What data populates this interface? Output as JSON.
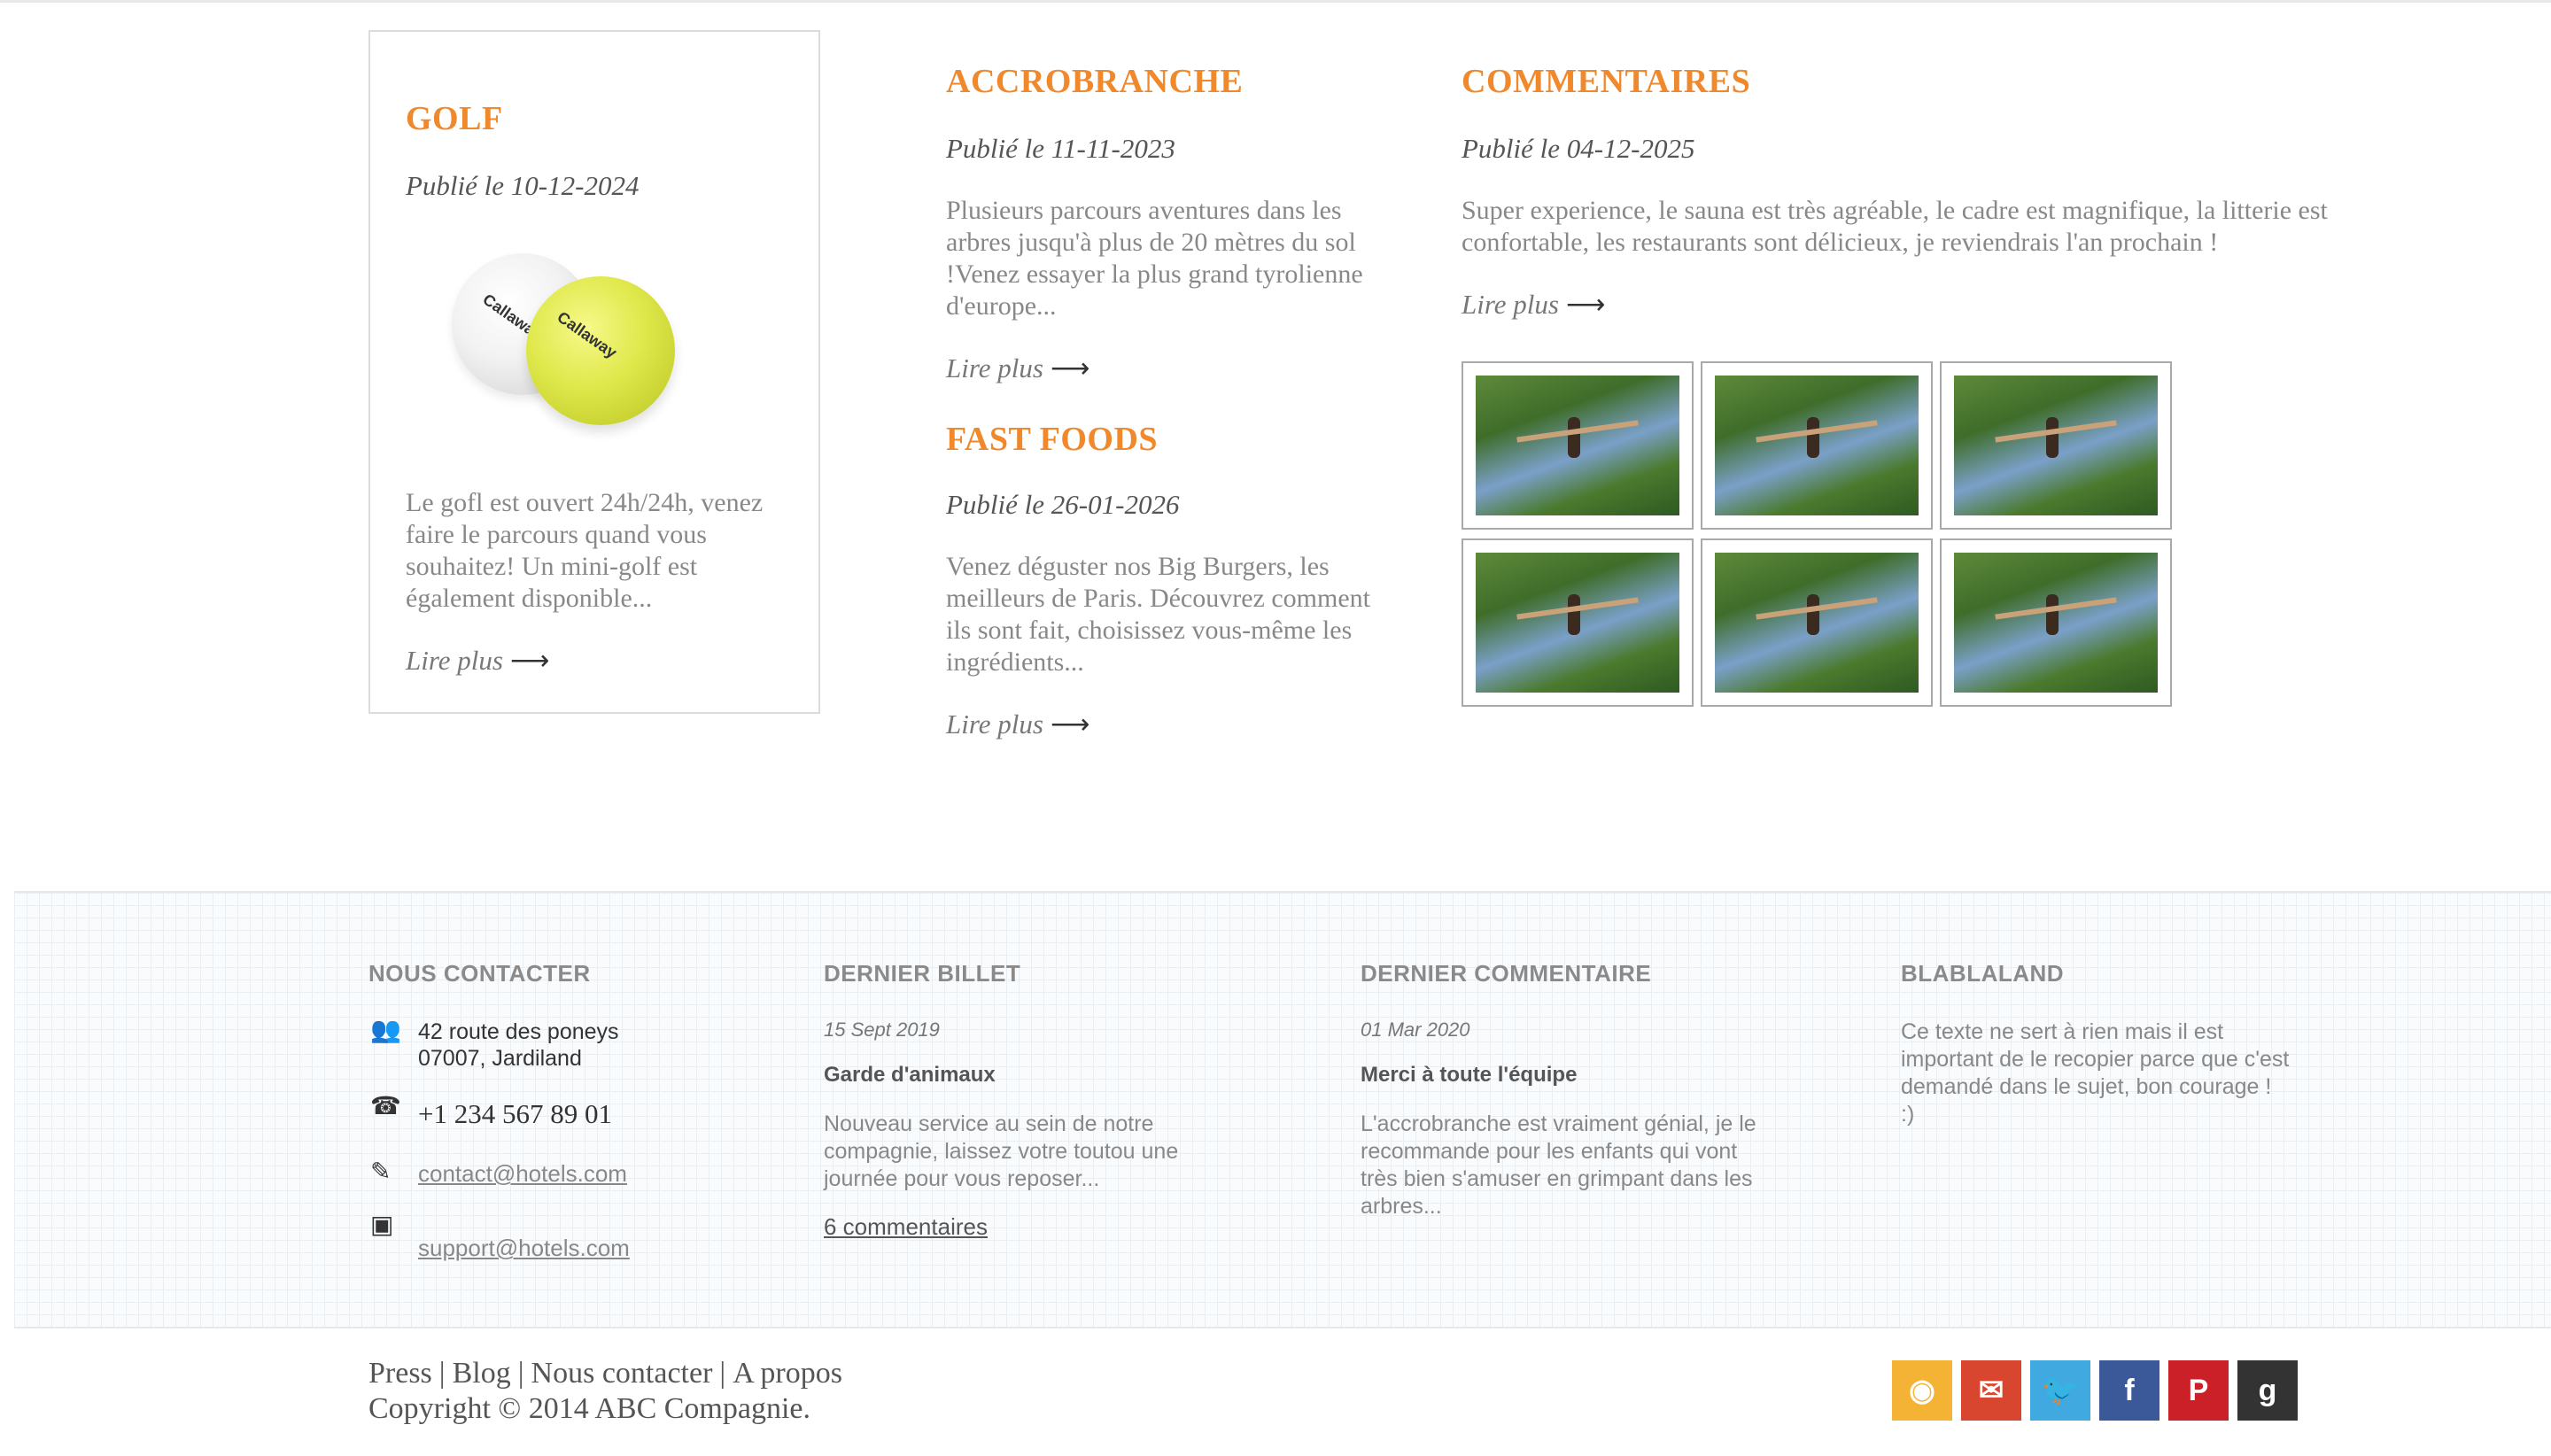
{
  "golf": {
    "title": "GOLF",
    "date": "Publié le 10-12-2024",
    "text": "Le gofl est ouvert 24h/24h, venez faire le parcours quand vous souhaitez! Un mini-golf est également disponible...",
    "more": "Lire plus",
    "ball_brand": "Callaway"
  },
  "accrobranche": {
    "title": "ACCROBRANCHE",
    "date": "Publié le 11-11-2023",
    "text": "Plusieurs parcours aventures dans les arbres jusqu'à plus de 20 mètres du sol !Venez essayer la plus grand tyrolienne d'europe...",
    "more": "Lire plus"
  },
  "fastfoods": {
    "title": "FAST FOODS",
    "date": "Publié le 26-01-2026",
    "text": "Venez déguster nos Big Burgers, les meilleurs de Paris. Découvrez comment ils sont fait, choisissez vous-même les ingrédients...",
    "more": "Lire plus"
  },
  "commentaires": {
    "title": "COMMENTAIRES",
    "date": "Publié le 04-12-2025",
    "text": "Super experience, le sauna est très agréable, le cadre est magnifique, la litterie est confortable, les restaurants sont délicieux, je reviendrais l'an prochain !",
    "more": "Lire plus",
    "gallery_count": 6
  },
  "footer": {
    "contact": {
      "heading": "NOUS CONTACTER",
      "address_line1": "42 route des poneys",
      "address_line2": "07007, Jardiland",
      "phone": "+1 234 567 89 01",
      "email1": "contact@hotels.com",
      "email2": "support@hotels.com"
    },
    "billet": {
      "heading": "DERNIER BILLET",
      "date": "15 Sept 2019",
      "title": "Garde d'animaux",
      "text": "Nouveau service au sein de notre compagnie, laissez votre toutou une journée pour vous reposer...",
      "comments": "6 commentaires"
    },
    "commentaire": {
      "heading": "DERNIER COMMENTAIRE",
      "date": "01 Mar 2020",
      "title": "Merci à toute l'équipe",
      "text": "L'accrobranche est vraiment génial, je le recommande pour les enfants qui vont très bien s'amuser en grimpant dans les arbres..."
    },
    "blablaland": {
      "heading": "BLABLALAND",
      "text": "Ce texte ne sert à rien mais il est important de le recopier parce que c'est demandé dans le sujet, bon courage ! :)"
    }
  },
  "bottom": {
    "links": [
      "Press",
      "Blog",
      "Nous contacter",
      "A propos"
    ],
    "separator": "|",
    "copyright": "Copyright © 2014 ABC Compagnie."
  },
  "social": [
    {
      "name": "rss-icon",
      "glyph": "◉",
      "color": "#f5b335"
    },
    {
      "name": "mail-icon",
      "glyph": "✉",
      "color": "#d9462f"
    },
    {
      "name": "twitter-icon",
      "glyph": "🐦",
      "color": "#3fa9e0"
    },
    {
      "name": "facebook-icon",
      "glyph": "f",
      "color": "#3b5998"
    },
    {
      "name": "pinterest-icon",
      "glyph": "P",
      "color": "#cb2027"
    },
    {
      "name": "google-plus-icon",
      "glyph": "g",
      "color": "#333333"
    }
  ]
}
